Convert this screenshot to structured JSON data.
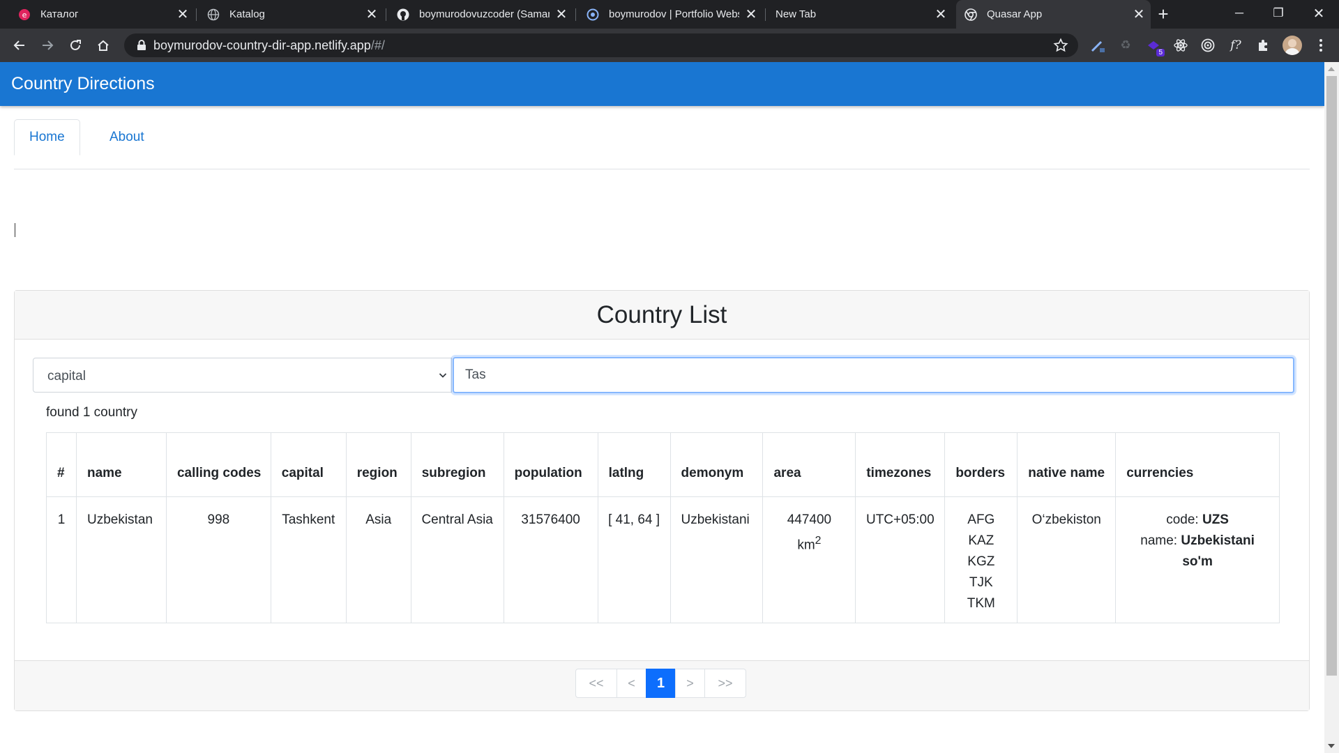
{
  "browser": {
    "tabs": [
      {
        "title": "Каталог",
        "icon": "eduhub-icon"
      },
      {
        "title": "Katalog",
        "icon": "globe-icon"
      },
      {
        "title": "boymurodovuzcoder (Samandar",
        "icon": "github-icon"
      },
      {
        "title": "boymurodov | Portfolio Website",
        "icon": "portfolio-icon"
      },
      {
        "title": "New Tab",
        "icon": ""
      },
      {
        "title": "Quasar App",
        "icon": "chrome-icon"
      }
    ],
    "new_tab": "+",
    "url_host": "boymurodov-country-dir-app.netlify.app",
    "url_path": "/#/",
    "extension_badge": "5"
  },
  "app": {
    "title": "Country Directions",
    "nav": [
      {
        "label": "Home"
      },
      {
        "label": "About"
      }
    ]
  },
  "list": {
    "title": "Country List",
    "filter_selected": "capital",
    "search_value": "Tas",
    "found_text": "found 1 country",
    "headers": {
      "index": "#",
      "name": "name",
      "calling_codes": "calling codes",
      "capital": "capital",
      "region": "region",
      "subregion": "subregion",
      "population": "population",
      "latlng": "latlng",
      "demonym": "demonym",
      "area": "area",
      "timezones": "timezones",
      "borders": "borders",
      "native_name": "native name",
      "currencies": "currencies"
    },
    "rows": [
      {
        "index": "1",
        "name": "Uzbekistan",
        "calling_codes": "998",
        "capital": "Tashkent",
        "region": "Asia",
        "subregion": "Central Asia",
        "population": "31576400",
        "latlng": "[ 41, 64 ]",
        "demonym": "Uzbekistani",
        "area_value": "447400",
        "area_unit": "km",
        "area_sup": "2",
        "timezones": "UTC+05:00",
        "borders": [
          "AFG",
          "KAZ",
          "KGZ",
          "TJK",
          "TKM"
        ],
        "native_name": "O‘zbekiston",
        "currency_code_label": "code:",
        "currency_code": "UZS",
        "currency_name_label": "name:",
        "currency_name": "Uzbekistani so'm"
      }
    ],
    "pagination": {
      "first": "<<",
      "prev": "<",
      "current": "1",
      "next": ">",
      "last": ">>"
    }
  }
}
